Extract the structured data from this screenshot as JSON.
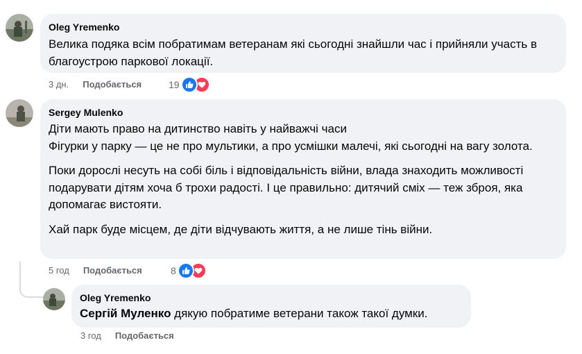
{
  "comments": [
    {
      "author": "Oleg Yremenko",
      "paragraphs": [
        "Велика подяка всім побратимам ветеранам які сьогодні знайшли час і прийняли участь в благоустрою паркової локації."
      ],
      "time": "3 дн.",
      "like_label": "Подобається",
      "reactions_count": "19"
    },
    {
      "author": "Sergey Mulenko",
      "paragraphs": [
        "Діти мають право на дитинство навіть у найважчі часи\nФігурки у парку — це не про мультики, а про усмішки малечі, які сьогодні на вагу золота.",
        "Поки дорослі несуть на собі біль і відповідальність війни, влада знаходить можливості подарувати дітям хоча б трохи радості. І це правильно: дитячий сміх — теж зброя, яка допомагає вистояти.",
        "Хай парк буде місцем, де діти відчувають життя, а не лише тінь війни."
      ],
      "time": "5 год",
      "like_label": "Подобається",
      "reactions_count": "8"
    }
  ],
  "reply": {
    "author": "Oleg Yremenko",
    "mention": "Сергій Муленко",
    "text": " дякую побратиме ветерани також такої думки.",
    "time": "3 год",
    "like_label": "Подобається"
  },
  "reaction_icons": [
    "like-icon",
    "love-icon"
  ],
  "colors": {
    "bubble": "#f0f2f5",
    "meta_text": "#65676b",
    "like_blue": "#1877f2",
    "love_red": "#f33e58",
    "thread_line": "#d8dadf"
  }
}
